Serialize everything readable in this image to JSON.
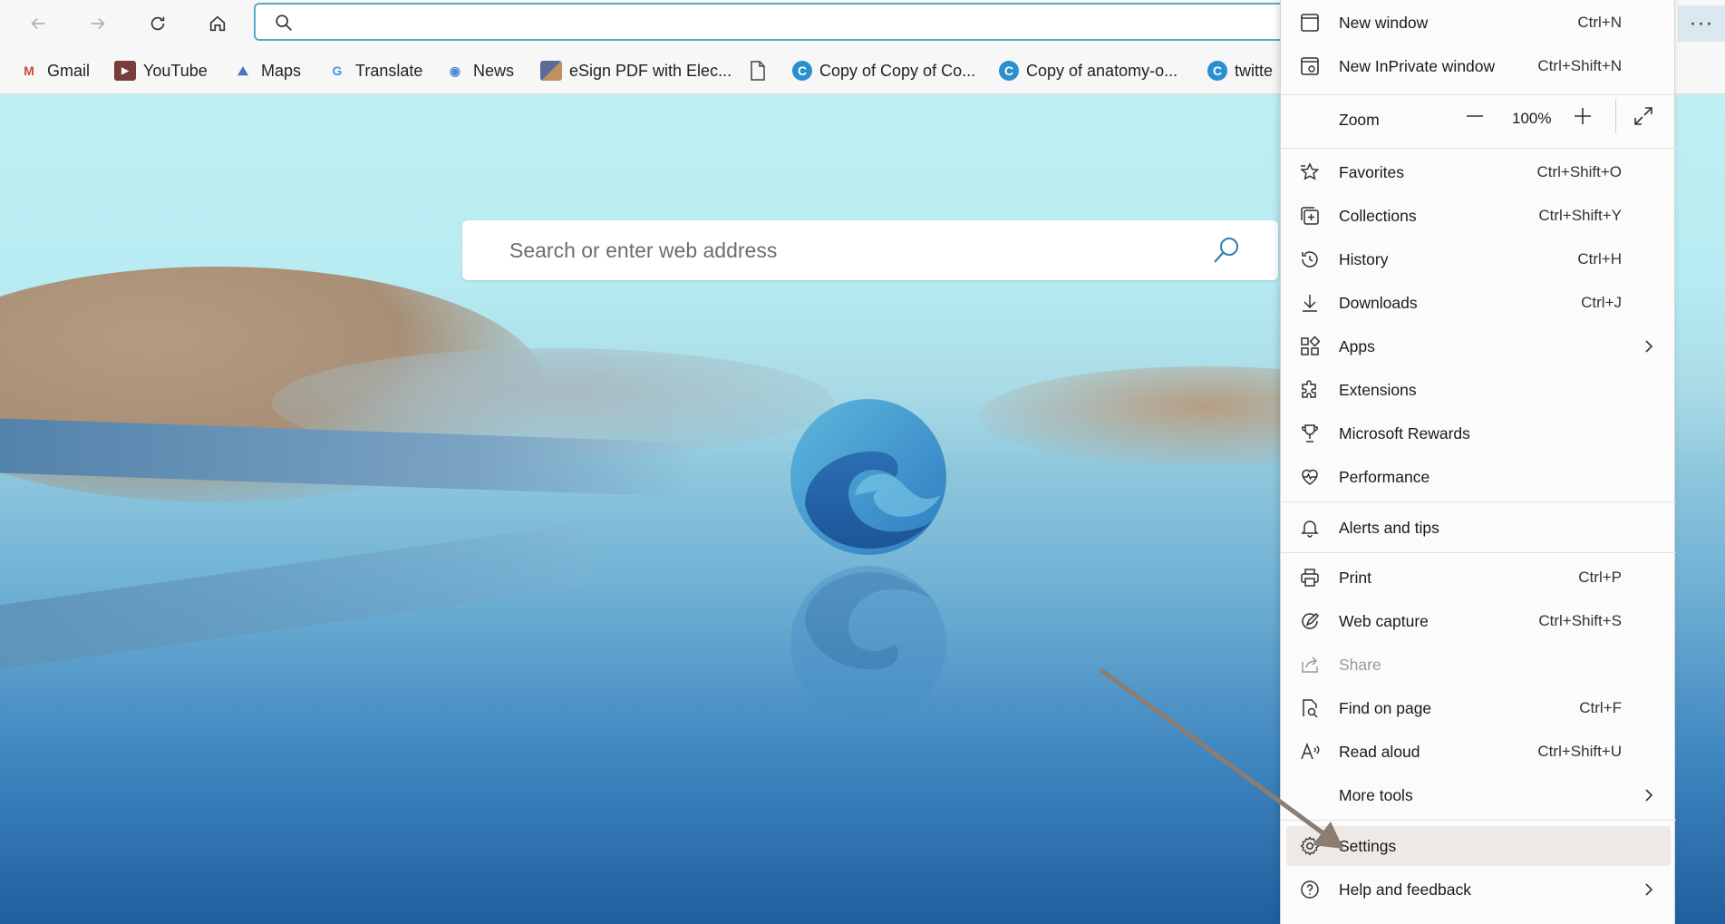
{
  "toolbar": {
    "address_value": "",
    "more_label": "···"
  },
  "bookmarks": [
    {
      "label": "Gmail",
      "icon": "gmail-icon",
      "color": "#d44638"
    },
    {
      "label": "YouTube",
      "icon": "youtube-icon",
      "color": "#7a3b3b"
    },
    {
      "label": "Maps",
      "icon": "maps-icon",
      "color": "#4a76c0"
    },
    {
      "label": "Translate",
      "icon": "translate-icon",
      "color": "#4a90e2"
    },
    {
      "label": "News",
      "icon": "news-icon",
      "color": "#4a8ad6"
    },
    {
      "label": "eSign PDF with Elec...",
      "icon": "esign-icon",
      "color": "#5a6b9a"
    },
    {
      "label": "",
      "icon": "document-icon",
      "color": "#555555"
    },
    {
      "label": "Copy of Copy of Co...",
      "icon": "canva-icon",
      "color": "#2a8fcf"
    },
    {
      "label": "Copy of anatomy-o...",
      "icon": "canva-icon",
      "color": "#2a8fcf"
    },
    {
      "label": "twitte",
      "icon": "canva-icon",
      "color": "#2a8fcf"
    }
  ],
  "search": {
    "placeholder": "Search or enter web address"
  },
  "menu": {
    "new_window": {
      "label": "New window",
      "shortcut": "Ctrl+N"
    },
    "new_inprivate": {
      "label": "New InPrivate window",
      "shortcut": "Ctrl+Shift+N"
    },
    "zoom": {
      "label": "Zoom",
      "value": "100%"
    },
    "favorites": {
      "label": "Favorites",
      "shortcut": "Ctrl+Shift+O"
    },
    "collections": {
      "label": "Collections",
      "shortcut": "Ctrl+Shift+Y"
    },
    "history": {
      "label": "History",
      "shortcut": "Ctrl+H"
    },
    "downloads": {
      "label": "Downloads",
      "shortcut": "Ctrl+J"
    },
    "apps": {
      "label": "Apps"
    },
    "extensions": {
      "label": "Extensions"
    },
    "rewards": {
      "label": "Microsoft Rewards"
    },
    "performance": {
      "label": "Performance"
    },
    "alerts": {
      "label": "Alerts and tips"
    },
    "print": {
      "label": "Print",
      "shortcut": "Ctrl+P"
    },
    "web_capture": {
      "label": "Web capture",
      "shortcut": "Ctrl+Shift+S"
    },
    "share": {
      "label": "Share"
    },
    "find": {
      "label": "Find on page",
      "shortcut": "Ctrl+F"
    },
    "read_aloud": {
      "label": "Read aloud",
      "shortcut": "Ctrl+Shift+U"
    },
    "more_tools": {
      "label": "More tools"
    },
    "settings": {
      "label": "Settings"
    },
    "help": {
      "label": "Help and feedback"
    }
  },
  "colors": {
    "accent": "#5aa8c8",
    "menu_bg": "#fbfbfb",
    "highlight": "#eee9e4",
    "annotation_arrow": "#8b7d72"
  }
}
